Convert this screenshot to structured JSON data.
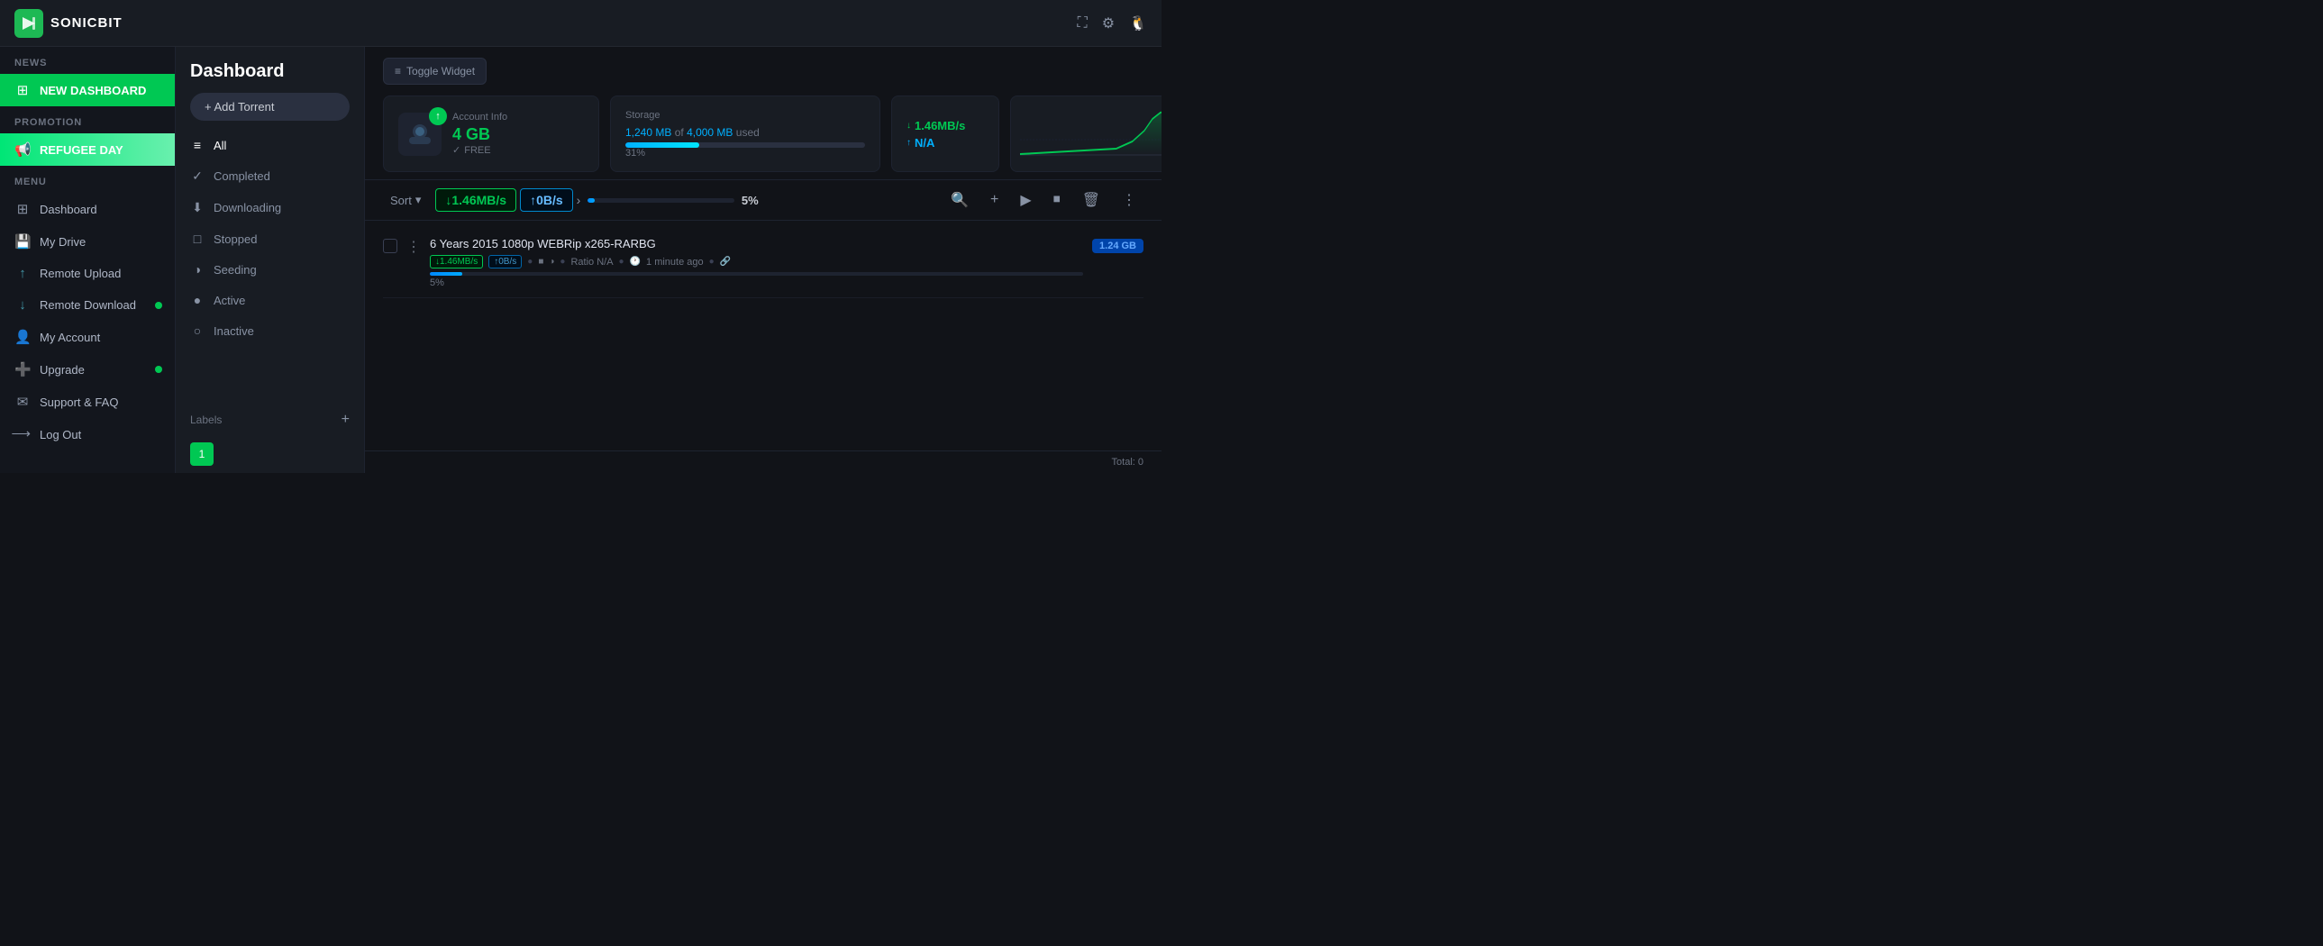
{
  "app": {
    "name": "SONICBIT",
    "logo_symbol": "⚡"
  },
  "header": {
    "expand_icon": "⛶",
    "settings_icon": "⚙",
    "user_icon": "👤"
  },
  "left_sidebar": {
    "sections": [
      {
        "label": "News",
        "items": [
          {
            "id": "new-dashboard",
            "icon": "🏠",
            "label": "NEW DASHBOARD",
            "active": "green"
          }
        ]
      },
      {
        "label": "Promotion",
        "items": [
          {
            "id": "refugee-day",
            "icon": "📢",
            "label": "REFUGEE DAY",
            "active": "green2"
          }
        ]
      },
      {
        "label": "Menu",
        "items": [
          {
            "id": "dashboard",
            "icon": "⊞",
            "label": "Dashboard",
            "badge": false
          },
          {
            "id": "my-drive",
            "icon": "💾",
            "label": "My Drive",
            "badge": false
          },
          {
            "id": "remote-upload",
            "icon": "↑",
            "label": "Remote Upload",
            "badge": false
          },
          {
            "id": "remote-download",
            "icon": "↓",
            "label": "Remote Download",
            "badge": true
          },
          {
            "id": "my-account",
            "icon": "👤",
            "label": "My Account",
            "badge": false
          },
          {
            "id": "upgrade",
            "icon": "➕",
            "label": "Upgrade",
            "badge": true
          },
          {
            "id": "support-faq",
            "icon": "✉",
            "label": "Support & FAQ",
            "badge": false
          },
          {
            "id": "log-out",
            "icon": "→",
            "label": "Log Out",
            "badge": false
          }
        ]
      }
    ]
  },
  "middle_sidebar": {
    "title": "Dashboard",
    "add_torrent_label": "+ Add Torrent",
    "filters": [
      {
        "id": "all",
        "icon": "≡",
        "label": "All"
      },
      {
        "id": "completed",
        "icon": "✓",
        "label": "Completed"
      },
      {
        "id": "downloading",
        "icon": "⬇",
        "label": "Downloading"
      },
      {
        "id": "stopped",
        "icon": "□",
        "label": "Stopped"
      },
      {
        "id": "seeding",
        "icon": "◑",
        "label": "Seeding"
      },
      {
        "id": "active",
        "icon": "●",
        "label": "Active"
      },
      {
        "id": "inactive",
        "icon": "○",
        "label": "Inactive"
      }
    ],
    "labels_section_label": "Labels",
    "labels_add_icon": "+",
    "pagination": {
      "current": 1
    }
  },
  "toolbar": {
    "toggle_widget_label": "Toggle Widget",
    "toggle_widget_icon": "≡"
  },
  "widgets": {
    "account": {
      "label": "Account Info",
      "storage_gb": "4 GB",
      "free_label": "FREE",
      "free_icon": "✓"
    },
    "storage": {
      "label": "Storage",
      "used_mb": "1,240 MB",
      "total_mb": "4,000 MB",
      "used_label": "used",
      "percentage": "31%",
      "fill_percent": 31
    },
    "speed_down": {
      "label": "↓ 1.46MB/s"
    },
    "speed_up": {
      "label": "↑ N/A"
    }
  },
  "torrent_controls": {
    "sort_label": "Sort",
    "sort_icon": "▾",
    "search_icon": "🔍",
    "add_icon": "+",
    "play_icon": "▶",
    "pause_icon": "⏹",
    "delete_icon": "🗑",
    "more_icon": "⋮"
  },
  "speed_display": {
    "download": "↓1.46MB/s",
    "upload": "↑0B/s",
    "arrow_icon": "›"
  },
  "torrent_progress": {
    "percentage": "5%",
    "fill_percent": 5
  },
  "torrents": [
    {
      "id": 1,
      "name": "6 Years 2015 1080p WEBRip x265-RARBG",
      "speed_down": "↓1.46MB/s",
      "speed_up": "↑0B/s",
      "ratio": "Ratio N/A",
      "time_ago": "1 minute ago",
      "progress_percent": 5,
      "progress_label": "5%",
      "size": "1.24 GB"
    }
  ],
  "footer": {
    "total_label": "Total: 0"
  },
  "colors": {
    "green_accent": "#00c853",
    "blue_accent": "#00b0ff",
    "bg_dark": "#111318",
    "bg_medium": "#181c23",
    "bg_sidebar": "#13161d"
  }
}
